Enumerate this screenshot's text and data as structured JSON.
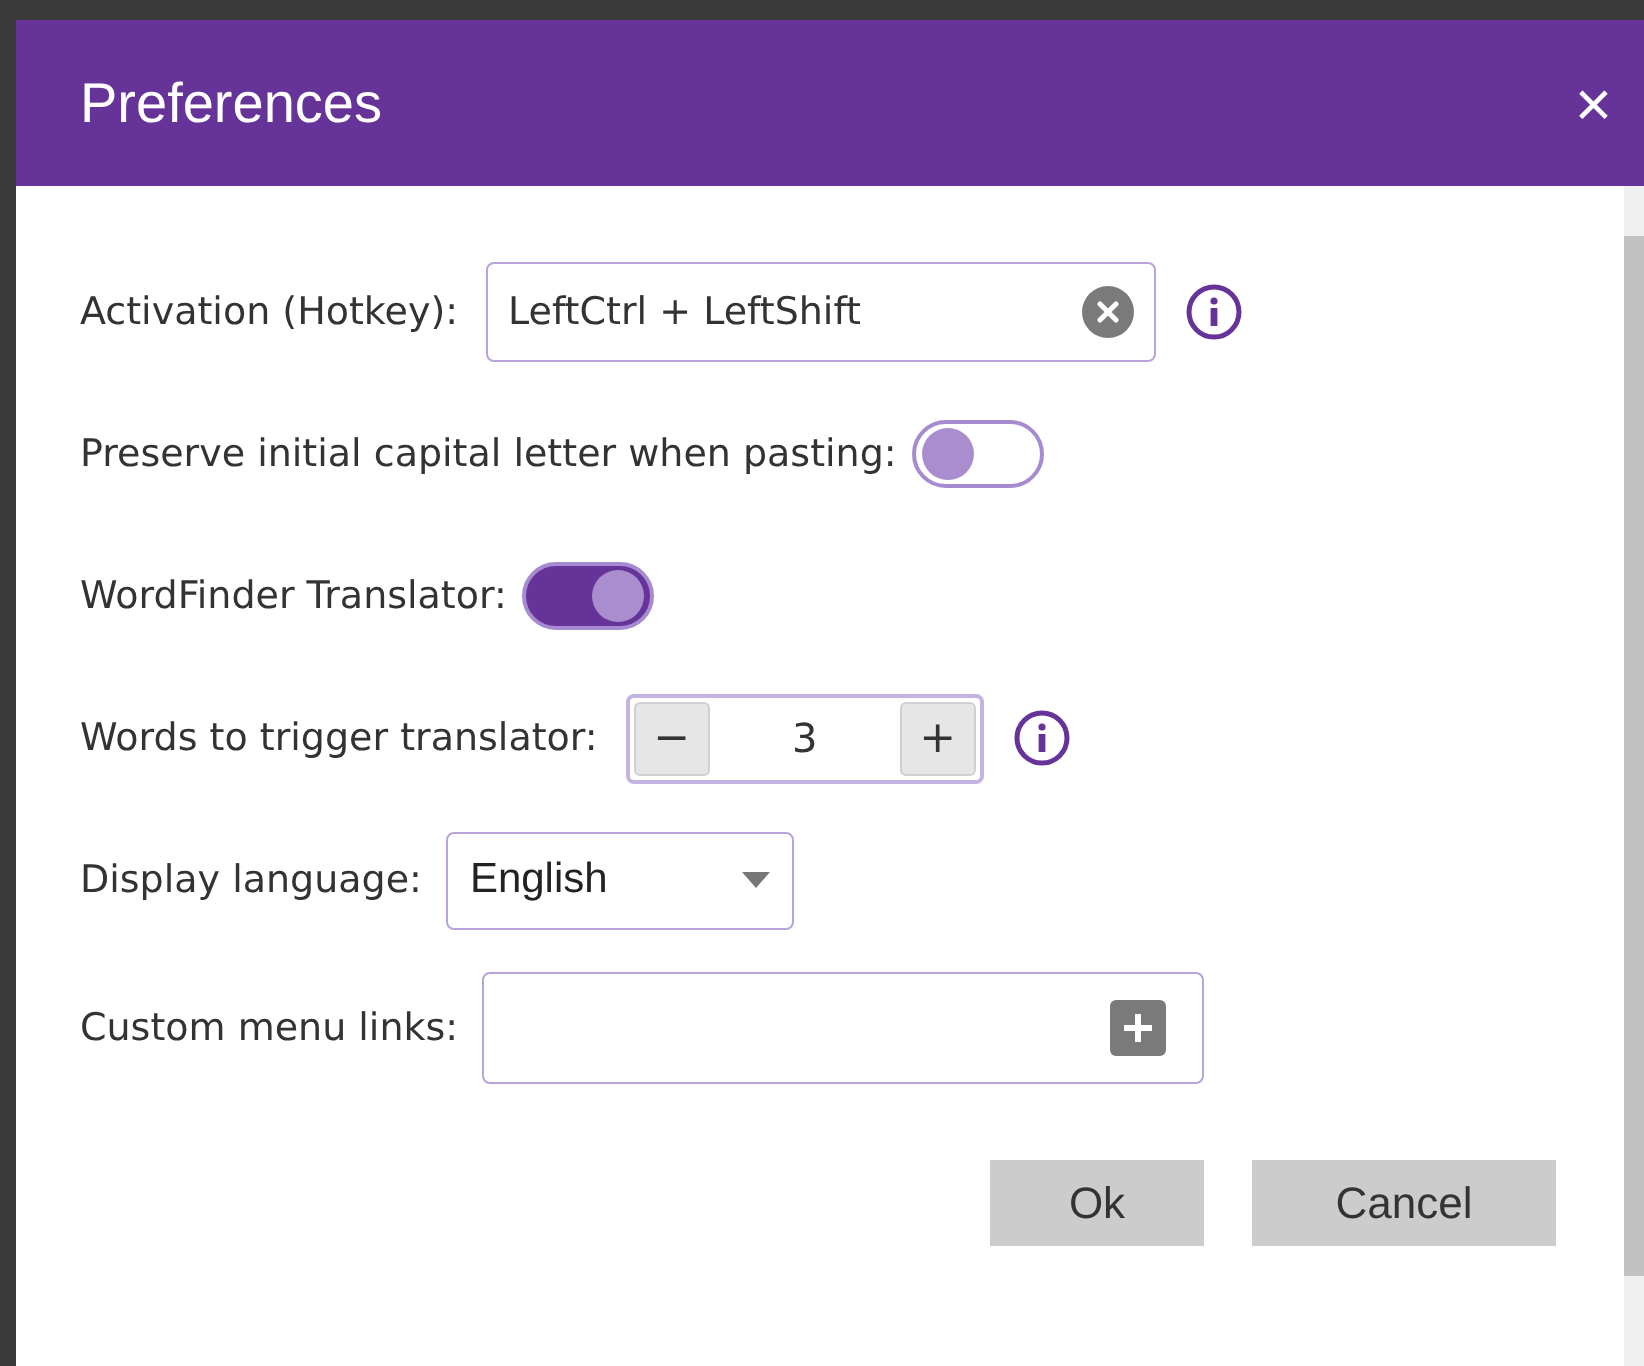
{
  "dialog": {
    "title": "Preferences",
    "close": "×"
  },
  "rows": [
    {
      "kind": "hotkey",
      "label": "Activation (Hotkey):",
      "value": "LeftCtrl + LeftShift"
    },
    {
      "kind": "toggle",
      "label": "Preserve initial capital letter when pasting:",
      "on": false
    },
    {
      "kind": "toggle",
      "label": "WordFinder Translator:",
      "on": true
    },
    {
      "kind": "stepper",
      "label": "Words to trigger translator:",
      "value": "3",
      "minus": "−",
      "plus": "+"
    },
    {
      "kind": "select",
      "label": "Display language:",
      "value": "English"
    },
    {
      "kind": "links",
      "label": "Custom menu links:"
    }
  ],
  "buttons": [
    "Ok",
    "Cancel"
  ]
}
